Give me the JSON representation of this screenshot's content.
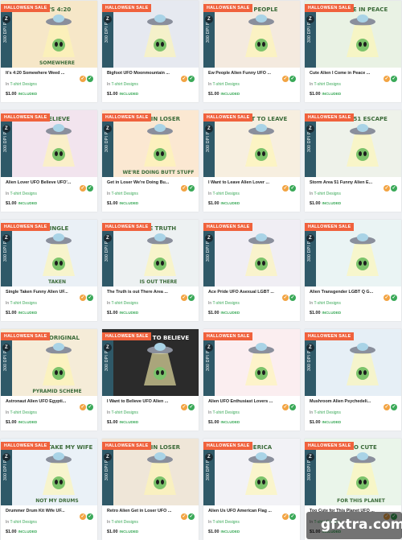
{
  "sale_label": "HALLOWEEN SALE",
  "dpi_label": "300 DPI PNG",
  "brand_mark": "Z",
  "category_prefix": "In",
  "price_suffix": "INCLUDED",
  "watermark": "gfxtra.com",
  "colors": {
    "sale": "#f0623d",
    "strip": "#2f5968",
    "green": "#3aa958",
    "orange": "#f2a443"
  },
  "products": [
    {
      "title": "It's 4:20 Somewhere Weed ...",
      "category": "T-shirt Designs",
      "price": "$1.00",
      "art_text": "IT'S 4:20",
      "art_text2": "SOMEWHERE",
      "icon": "moon-alien-icon"
    },
    {
      "title": "Bigfoot UFO Moonmountain ...",
      "category": "T-shirt Designs",
      "price": "$1.00",
      "art_text": "",
      "art_text2": "",
      "icon": "bigfoot-ufo-icon"
    },
    {
      "title": "Ew People Alien Funny UFO ...",
      "category": "T-shirt Designs",
      "price": "$1.00",
      "art_text": "EW PEOPLE",
      "art_text2": "",
      "icon": "alien-head-icon"
    },
    {
      "title": "Cute Alien I Come in Peace ...",
      "category": "T-shirt Designs",
      "price": "$1.00",
      "art_text": "I COME IN PEACE",
      "art_text2": "",
      "icon": "alien-peace-icon"
    },
    {
      "title": "Alien Lover UFO Believe UFO'...",
      "category": "T-shirt Designs",
      "price": "$1.00",
      "art_text": "BELIEVE",
      "art_text2": "",
      "icon": "ufo-beam-icon"
    },
    {
      "title": "Get in Loser We're Doing Bu...",
      "category": "T-shirt Designs",
      "price": "$1.00",
      "art_text": "GET IN LOSER",
      "art_text2": "WE'RE DOING BUTT STUFF",
      "icon": "sunset-ufo-icon"
    },
    {
      "title": "I Want to Leave Alien Lover ...",
      "category": "T-shirt Designs",
      "price": "$1.00",
      "art_text": "I WANT TO LEAVE",
      "art_text2": "",
      "icon": "arch-ufo-icon"
    },
    {
      "title": "Storm Area 51 Funny Alien E...",
      "category": "T-shirt Designs",
      "price": "$1.00",
      "art_text": "AREA 51 ESCAPE",
      "art_text2": "",
      "icon": "alien-head-icon"
    },
    {
      "title": "Single Taken Funny Alien UF...",
      "category": "T-shirt Designs",
      "price": "$1.00",
      "art_text": "SINGLE",
      "art_text2": "TAKEN",
      "icon": "ufo-checkbox-icon"
    },
    {
      "title": "The Truth is out There Area ...",
      "category": "T-shirt Designs",
      "price": "$1.00",
      "art_text": "THE TRUTH",
      "art_text2": "IS OUT THERE",
      "icon": "mountain-ufo-icon"
    },
    {
      "title": "Ace Pride UFO Asexual LGBT ...",
      "category": "T-shirt Designs",
      "price": "$1.00",
      "art_text": "",
      "art_text2": "",
      "icon": "ufo-abduction-icon"
    },
    {
      "title": "Alien Transgender LGBT Q G...",
      "category": "T-shirt Designs",
      "price": "$1.00",
      "art_text": "",
      "art_text2": "",
      "icon": "ufo-abduction-icon"
    },
    {
      "title": "Astronaut Alien UFO Egypti...",
      "category": "T-shirt Designs",
      "price": "$1.00",
      "art_text": "THE ORIGINAL",
      "art_text2": "PYRAMID SCHEME",
      "icon": "pyramid-ufo-icon"
    },
    {
      "title": "I Want to Believe UFO Alien ...",
      "category": "T-shirt Designs",
      "price": "$1.00",
      "art_text": "I WANT TO BELIEVE",
      "art_text2": "",
      "icon": "tshirt-mockup-icon"
    },
    {
      "title": "Alien UFO Enthusiast Lovers ...",
      "category": "T-shirt Designs",
      "price": "$1.00",
      "art_text": "",
      "art_text2": "",
      "icon": "heart-alien-icon"
    },
    {
      "title": "Mushroom Alien Psychedeli...",
      "category": "T-shirt Designs",
      "price": "$1.00",
      "art_text": "",
      "art_text2": "",
      "icon": "mushroom-ufo-icon"
    },
    {
      "title": "Drummer Drum Kit Wife UF...",
      "category": "T-shirt Designs",
      "price": "$1.00",
      "art_text": "PLEASE TAKE MY WIFE",
      "art_text2": "NOT MY DRUMS",
      "icon": "drum-ufo-icon"
    },
    {
      "title": "Retro Alien Get in Loser UFO ...",
      "category": "T-shirt Designs",
      "price": "$1.00",
      "art_text": "GET IN LOSER",
      "art_text2": "",
      "icon": "retro-ufo-icon"
    },
    {
      "title": "Alien Us UFO American Flag ...",
      "category": "T-shirt Designs",
      "price": "$1.00",
      "art_text": "MERICA",
      "art_text2": "",
      "icon": "alien-flag-icon"
    },
    {
      "title": "Too Cute for This Planet UFO ...",
      "category": "T-shirt Designs",
      "price": "$1.00",
      "art_text": "TOO CUTE",
      "art_text2": "FOR THIS PLANET",
      "icon": "planet-alien-icon"
    }
  ]
}
